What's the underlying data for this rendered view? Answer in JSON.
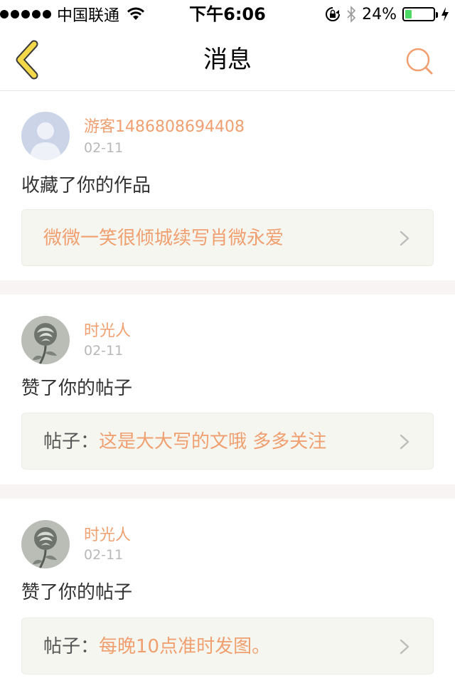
{
  "status_bar": {
    "carrier": "中国联通",
    "time": "下午6:06",
    "battery_percent_label": "24%",
    "battery_level": 0.24
  },
  "nav": {
    "title": "消息"
  },
  "messages": [
    {
      "username": "游客1486808694408",
      "date": "02-11",
      "action": "收藏了你的作品",
      "link_prefix": "",
      "link_title": "微微一笑很倾城续写肖微永爱",
      "avatar": "default-avatar-icon"
    },
    {
      "username": "时光人",
      "date": "02-11",
      "action": "赞了你的帖子",
      "link_prefix": "帖子：",
      "link_title": "这是大大写的文哦 多多关注",
      "avatar": "rose-avatar"
    },
    {
      "username": "时光人",
      "date": "02-11",
      "action": "赞了你的帖子",
      "link_prefix": "帖子：",
      "link_title": "每晚10点准时发图。",
      "avatar": "rose-avatar"
    }
  ],
  "colors": {
    "accent": "#f0a070",
    "back_icon": "#f3d84a",
    "separator": "#f7f4f3",
    "link_box": "#f6f6f1"
  }
}
